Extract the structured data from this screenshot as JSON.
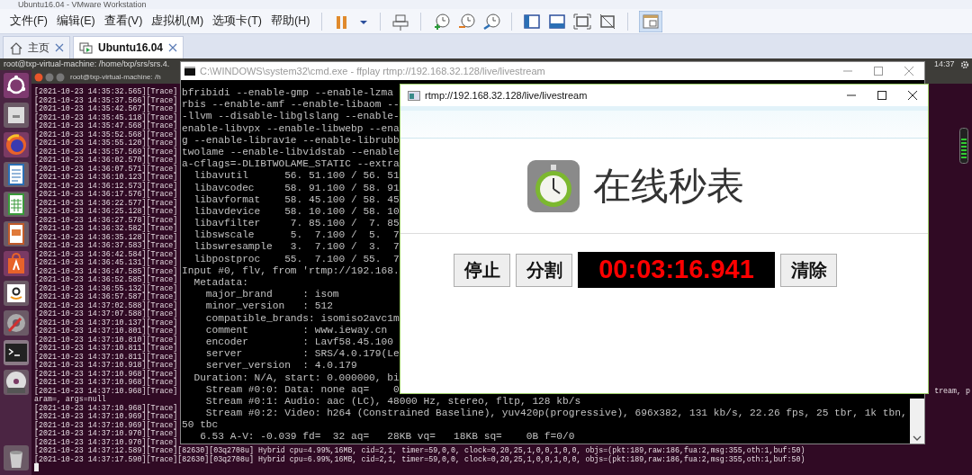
{
  "window": {
    "title": "Ubuntu16.04 - VMware Workstation"
  },
  "menu": [
    "文件(F)",
    "编辑(E)",
    "查看(V)",
    "虚拟机(M)",
    "选项卡(T)",
    "帮助(H)"
  ],
  "tabs": [
    {
      "label": "主页",
      "selected": false
    },
    {
      "label": "Ubuntu16.04",
      "selected": true
    }
  ],
  "guest": {
    "top_panel": {
      "title": "root@txp-virtual-machine: /home/txp/srs/srs.4.",
      "clock": "14:37"
    },
    "terminal": {
      "title": "root@txp-virtual-machine: /h",
      "lines": [
        {
          "text": "[2021-10-23 14:35:32.565][Trace]"
        },
        {
          "text": "[2021-10-23 14:35:37.566][Trace]"
        },
        {
          "text": "[2021-10-23 14:35:42.567][Trace]"
        },
        {
          "text": "[2021-10-23 14:35:45.118][Trace]"
        },
        {
          "text": "[2021-10-23 14:35:47.568][Trace]"
        },
        {
          "text": "[2021-10-23 14:35:52.568][Trace]"
        },
        {
          "text": "[2021-10-23 14:35:55.120][Trace]"
        },
        {
          "text": "[2021-10-23 14:35:57.569][Trace]"
        },
        {
          "text": "[2021-10-23 14:36:02.570][Trace]"
        },
        {
          "text": "[2021-10-23 14:36:07.571][Trace]"
        },
        {
          "text": "[2021-10-23 14:36:10.123][Trace]"
        },
        {
          "text": "[2021-10-23 14:36:12.573][Trace]"
        },
        {
          "text": "[2021-10-23 14:36:17.576][Trace]"
        },
        {
          "text": "[2021-10-23 14:36:22.577][Trace]"
        },
        {
          "text": "[2021-10-23 14:36:25.128][Trace]"
        },
        {
          "text": "[2021-10-23 14:36:27.578][Trace]"
        },
        {
          "text": "[2021-10-23 14:36:32.582][Trace]"
        },
        {
          "text": "[2021-10-23 14:36:35.128][Trace]"
        },
        {
          "text": "[2021-10-23 14:36:37.583][Trace]"
        },
        {
          "text": "[2021-10-23 14:36:42.584][Trace]"
        },
        {
          "text": "[2021-10-23 14:36:45.131][Trace]"
        },
        {
          "text": "[2021-10-23 14:36:47.585][Trace]"
        },
        {
          "text": "[2021-10-23 14:36:52.585][Trace]"
        },
        {
          "text": "[2021-10-23 14:36:55.132][Trace]"
        },
        {
          "text": "[2021-10-23 14:36:57.587][Trace]"
        },
        {
          "text": "[2021-10-23 14:37:02.588][Trace]"
        },
        {
          "text": "[2021-10-23 14:37:07.588][Trace]"
        },
        {
          "text": "[2021-10-23 14:37:10.137][Trace]"
        },
        {
          "text": "[2021-10-23 14:37:10.801][Trace]"
        },
        {
          "text": "[2021-10-23 14:37:10.810][Trace]"
        },
        {
          "text": "[2021-10-23 14:37:10.811][Trace]"
        },
        {
          "text": "[2021-10-23 14:37:10.811][Trace]"
        },
        {
          "text": "[2021-10-23 14:37:10.918][Trace]"
        },
        {
          "text": "[2021-10-23 14:37:10.968][Trace]"
        },
        {
          "text": "[2021-10-23 14:37:10.968][Trace]"
        },
        {
          "text": "[2021-10-23 14:37:10.968][Trace]",
          "tail": "tream, p"
        },
        {
          "text": "aram=, args=null"
        },
        {
          "text": "[2021-10-23 14:37:10.968][Trace]"
        },
        {
          "text": "[2021-10-23 14:37:10.969][Trace]"
        },
        {
          "text": "[2021-10-23 14:37:10.969][Trace]"
        },
        {
          "text": "[2021-10-23 14:37:10.970][Trace]"
        },
        {
          "text": "[2021-10-23 14:37:10.970][Trace]"
        },
        {
          "text": "[2021-10-23 14:37:12.589][Trace][82630][03q2708u] Hybrid cpu=4.99%,16MB, cid=2,1, timer=59,0,0, clock=0,20,25,1,0,0,1,0,0, objs=(pkt:189,raw:186,fua:2,msg:355,oth:1,buf:50)"
        },
        {
          "text": "[2021-10-23 14:37:17.590][Trace][82630][03q2708u] Hybrid cpu=6.99%,16MB, cid=2,1, timer=59,0,0, clock=0,20,25,1,0,0,1,0,0, objs=(pkt:189,raw:186,fua:2,msg:355,oth:1,buf:50)"
        }
      ]
    }
  },
  "cmd_window": {
    "title": "C:\\WINDOWS\\system32\\cmd.exe - ffplay  rtmp://192.168.32.128/live/livestream",
    "lines": [
      "bfribidi --enable-gmp --enable-lzma",
      "rbis --enable-amf --enable-libaom --",
      "-llvm --disable-libglslang --enable-",
      "enable-libvpx --enable-libwebp --ena",
      "g --enable-librav1e --enable-librubb",
      "twolame --enable-libvidstab --enable",
      "a-cflags=-DLIBTWOLAME_STATIC --extra",
      "  libavutil      56. 51.100 / 56. 51",
      "  libavcodec     58. 91.100 / 58. 91",
      "  libavformat    58. 45.100 / 58. 45",
      "  libavdevice    58. 10.100 / 58. 10",
      "  libavfilter     7. 85.100 /  7. 85",
      "  libswscale      5.  7.100 /  5.  7",
      "  libswresample   3.  7.100 /  3.  7",
      "  libpostproc    55.  7.100 / 55.  7",
      "Input #0, flv, from 'rtmp://192.168.",
      "  Metadata:",
      "    major_brand     : isom",
      "    minor_version   : 512",
      "    compatible_brands: isomiso2avc1m",
      "    comment         : www.ieway.cn",
      "    encoder         : Lavf58.45.100",
      "    server          : SRS/4.0.179(Le",
      "    server_version  : 4.0.179",
      "  Duration: N/A, start: 0.000000, bi",
      "    Stream #0:0: Data: none aq=    0",
      "    Stream #0:1: Audio: aac (LC), 48000 Hz, stereo, fltp, 128 kb/s",
      "    Stream #0:2: Video: h264 (Constrained Baseline), yuv420p(progressive), 696x382, 131 kb/s, 22.26 fps, 25 tbr, 1k tbn,",
      "50 tbc",
      "   6.53 A-V: -0.039 fd=  32 aq=   28KB vq=   18KB sq=    0B f=0/0"
    ]
  },
  "ffplay_window": {
    "title": "rtmp://192.168.32.128/live/livestream",
    "heading": "在线秒表",
    "controls": [
      {
        "kind": "button",
        "label": "停止"
      },
      {
        "kind": "button",
        "label": "分割"
      },
      {
        "kind": "display",
        "text": "00:03:16.941"
      },
      {
        "kind": "button",
        "label": "清除"
      }
    ]
  }
}
